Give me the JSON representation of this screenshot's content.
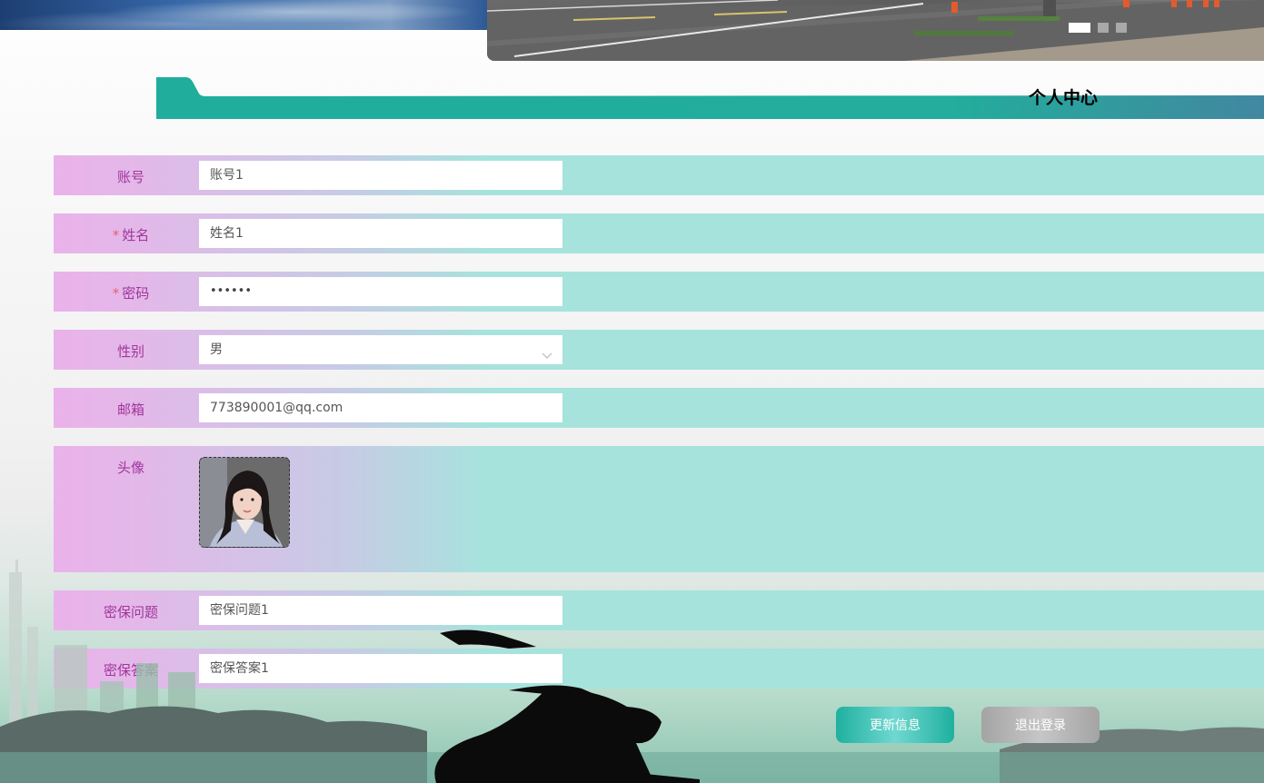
{
  "header": {
    "title": "个人中心",
    "carousel_slides": 3,
    "carousel_active": 1
  },
  "form": {
    "account": {
      "label": "账号",
      "value": "账号1"
    },
    "name": {
      "label": "姓名",
      "required_mark": "*",
      "value": "姓名1"
    },
    "password": {
      "label": "密码",
      "required_mark": "*",
      "value": "••••••"
    },
    "gender": {
      "label": "性别",
      "value": "男"
    },
    "email": {
      "label": "邮箱",
      "value": "773890001@qq.com"
    },
    "avatar": {
      "label": "头像"
    },
    "security_question": {
      "label": "密保问题",
      "value": "密保问题1"
    },
    "security_answer": {
      "label": "密保答案",
      "value": "密保答案1"
    }
  },
  "buttons": {
    "update_label": "更新信息",
    "logout_label": "退出登录"
  },
  "colors": {
    "accent": "#20ad9c",
    "label_text": "#a1359a",
    "required": "#e8606c",
    "row_left": "#eab2ea",
    "row_right": "#a6e3dd"
  },
  "icons": {
    "select_arrow": "chevron-down-icon"
  }
}
